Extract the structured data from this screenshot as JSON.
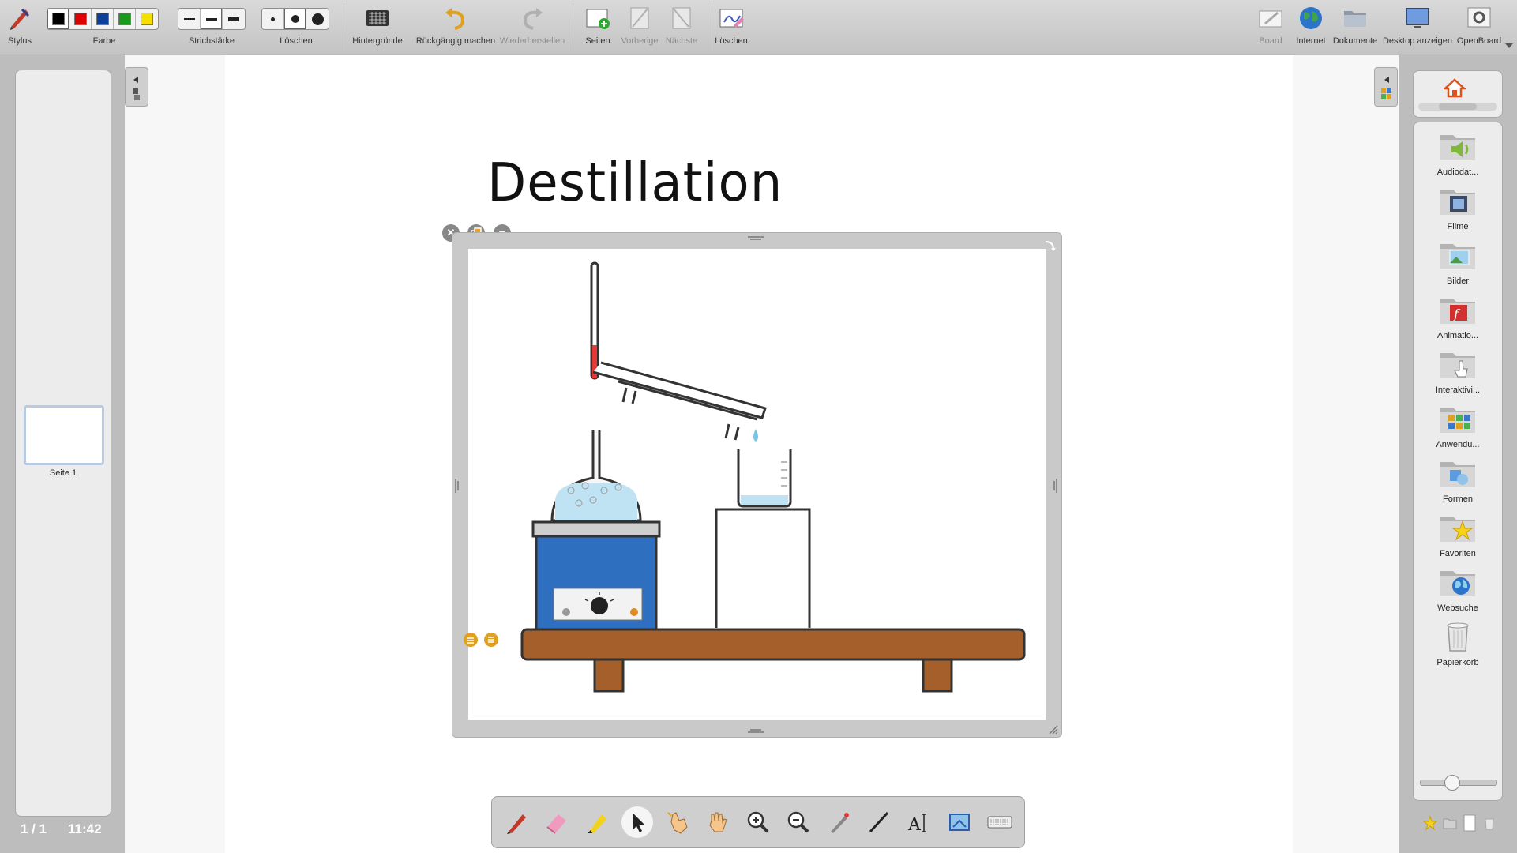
{
  "toolbar": {
    "stylus": "Stylus",
    "color": "Farbe",
    "stroke": "Strichstärke",
    "erase": "Löschen",
    "backgrounds": "Hintergründe",
    "undo": "Rückgängig machen",
    "redo": "Wiederherstellen",
    "pages": "Seiten",
    "previous": "Vorherige",
    "next": "Nächste",
    "clear": "Löschen",
    "board": "Board",
    "internet": "Internet",
    "documents": "Dokumente",
    "show_desktop": "Desktop anzeigen",
    "openboard": "OpenBoard"
  },
  "colors": [
    "#000000",
    "#e00000",
    "#0a3f9a",
    "#1a9a1a",
    "#f5e000"
  ],
  "pages_panel": {
    "thumb_label": "Seite 1",
    "counter": "1 / 1",
    "clock": "11:42"
  },
  "document": {
    "title": "Destillation"
  },
  "library": {
    "items": [
      {
        "label": "Audiodat..."
      },
      {
        "label": "Filme"
      },
      {
        "label": "Bilder"
      },
      {
        "label": "Animatio..."
      },
      {
        "label": "Interaktivi..."
      },
      {
        "label": "Anwendu..."
      },
      {
        "label": "Formen"
      },
      {
        "label": "Favoriten"
      },
      {
        "label": "Websuche"
      },
      {
        "label": "Papierkorb"
      }
    ]
  }
}
